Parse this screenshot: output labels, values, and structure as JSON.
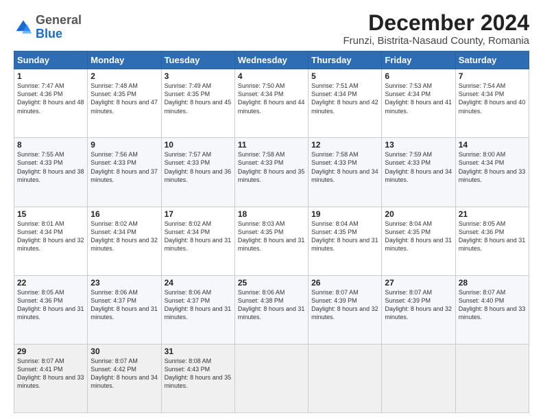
{
  "logo": {
    "general": "General",
    "blue": "Blue"
  },
  "title": "December 2024",
  "subtitle": "Frunzi, Bistrita-Nasaud County, Romania",
  "days": [
    "Sunday",
    "Monday",
    "Tuesday",
    "Wednesday",
    "Thursday",
    "Friday",
    "Saturday"
  ],
  "weeks": [
    [
      {
        "day": "1",
        "sunrise": "7:47 AM",
        "sunset": "4:36 PM",
        "daylight": "8 hours and 48 minutes."
      },
      {
        "day": "2",
        "sunrise": "7:48 AM",
        "sunset": "4:35 PM",
        "daylight": "8 hours and 47 minutes."
      },
      {
        "day": "3",
        "sunrise": "7:49 AM",
        "sunset": "4:35 PM",
        "daylight": "8 hours and 45 minutes."
      },
      {
        "day": "4",
        "sunrise": "7:50 AM",
        "sunset": "4:34 PM",
        "daylight": "8 hours and 44 minutes."
      },
      {
        "day": "5",
        "sunrise": "7:51 AM",
        "sunset": "4:34 PM",
        "daylight": "8 hours and 42 minutes."
      },
      {
        "day": "6",
        "sunrise": "7:53 AM",
        "sunset": "4:34 PM",
        "daylight": "8 hours and 41 minutes."
      },
      {
        "day": "7",
        "sunrise": "7:54 AM",
        "sunset": "4:34 PM",
        "daylight": "8 hours and 40 minutes."
      }
    ],
    [
      {
        "day": "8",
        "sunrise": "7:55 AM",
        "sunset": "4:33 PM",
        "daylight": "8 hours and 38 minutes."
      },
      {
        "day": "9",
        "sunrise": "7:56 AM",
        "sunset": "4:33 PM",
        "daylight": "8 hours and 37 minutes."
      },
      {
        "day": "10",
        "sunrise": "7:57 AM",
        "sunset": "4:33 PM",
        "daylight": "8 hours and 36 minutes."
      },
      {
        "day": "11",
        "sunrise": "7:58 AM",
        "sunset": "4:33 PM",
        "daylight": "8 hours and 35 minutes."
      },
      {
        "day": "12",
        "sunrise": "7:58 AM",
        "sunset": "4:33 PM",
        "daylight": "8 hours and 34 minutes."
      },
      {
        "day": "13",
        "sunrise": "7:59 AM",
        "sunset": "4:33 PM",
        "daylight": "8 hours and 34 minutes."
      },
      {
        "day": "14",
        "sunrise": "8:00 AM",
        "sunset": "4:34 PM",
        "daylight": "8 hours and 33 minutes."
      }
    ],
    [
      {
        "day": "15",
        "sunrise": "8:01 AM",
        "sunset": "4:34 PM",
        "daylight": "8 hours and 32 minutes."
      },
      {
        "day": "16",
        "sunrise": "8:02 AM",
        "sunset": "4:34 PM",
        "daylight": "8 hours and 32 minutes."
      },
      {
        "day": "17",
        "sunrise": "8:02 AM",
        "sunset": "4:34 PM",
        "daylight": "8 hours and 31 minutes."
      },
      {
        "day": "18",
        "sunrise": "8:03 AM",
        "sunset": "4:35 PM",
        "daylight": "8 hours and 31 minutes."
      },
      {
        "day": "19",
        "sunrise": "8:04 AM",
        "sunset": "4:35 PM",
        "daylight": "8 hours and 31 minutes."
      },
      {
        "day": "20",
        "sunrise": "8:04 AM",
        "sunset": "4:35 PM",
        "daylight": "8 hours and 31 minutes."
      },
      {
        "day": "21",
        "sunrise": "8:05 AM",
        "sunset": "4:36 PM",
        "daylight": "8 hours and 31 minutes."
      }
    ],
    [
      {
        "day": "22",
        "sunrise": "8:05 AM",
        "sunset": "4:36 PM",
        "daylight": "8 hours and 31 minutes."
      },
      {
        "day": "23",
        "sunrise": "8:06 AM",
        "sunset": "4:37 PM",
        "daylight": "8 hours and 31 minutes."
      },
      {
        "day": "24",
        "sunrise": "8:06 AM",
        "sunset": "4:37 PM",
        "daylight": "8 hours and 31 minutes."
      },
      {
        "day": "25",
        "sunrise": "8:06 AM",
        "sunset": "4:38 PM",
        "daylight": "8 hours and 31 minutes."
      },
      {
        "day": "26",
        "sunrise": "8:07 AM",
        "sunset": "4:39 PM",
        "daylight": "8 hours and 32 minutes."
      },
      {
        "day": "27",
        "sunrise": "8:07 AM",
        "sunset": "4:39 PM",
        "daylight": "8 hours and 32 minutes."
      },
      {
        "day": "28",
        "sunrise": "8:07 AM",
        "sunset": "4:40 PM",
        "daylight": "8 hours and 33 minutes."
      }
    ],
    [
      {
        "day": "29",
        "sunrise": "8:07 AM",
        "sunset": "4:41 PM",
        "daylight": "8 hours and 33 minutes."
      },
      {
        "day": "30",
        "sunrise": "8:07 AM",
        "sunset": "4:42 PM",
        "daylight": "8 hours and 34 minutes."
      },
      {
        "day": "31",
        "sunrise": "8:08 AM",
        "sunset": "4:43 PM",
        "daylight": "8 hours and 35 minutes."
      },
      null,
      null,
      null,
      null
    ]
  ],
  "labels": {
    "sunrise": "Sunrise:",
    "sunset": "Sunset:",
    "daylight": "Daylight:"
  }
}
